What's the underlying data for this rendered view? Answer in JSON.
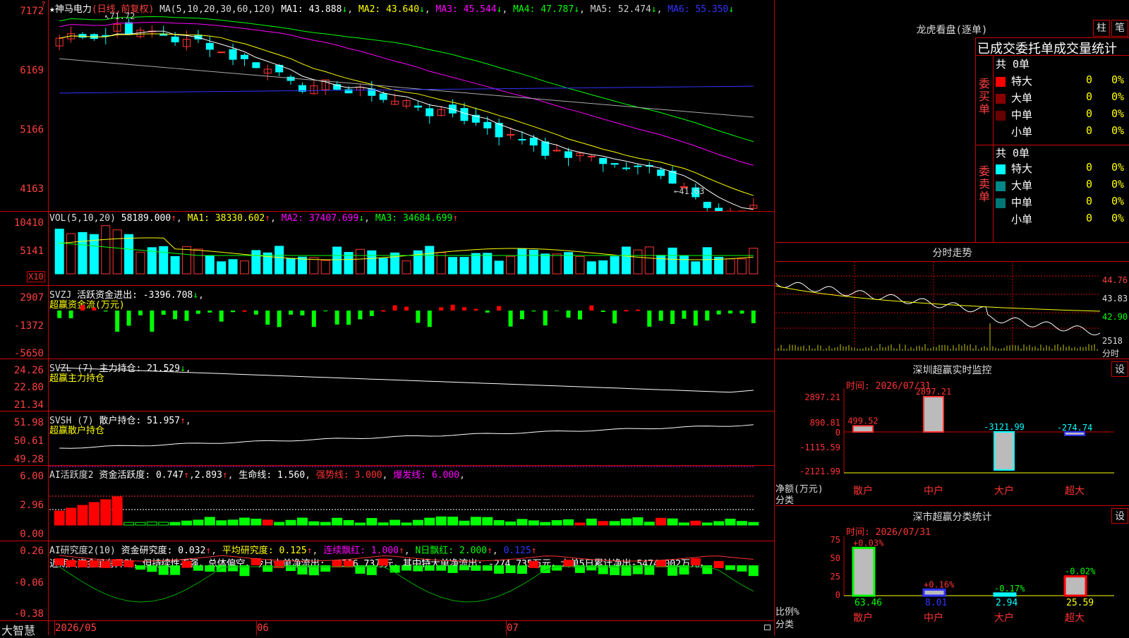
{
  "stock": {
    "star": "★",
    "name": "神马电力",
    "period": "(日线,前复权)",
    "ma_label": "MA(5,10,20,30,60,120)",
    "ma1": "MA1: 43.888",
    "ma2": "MA2: 43.640",
    "ma3": "MA3: 45.544",
    "ma4": "MA4: 47.787",
    "ma5": "MA5: 52.474",
    "ma6": "MA6: 55.350",
    "high_mark": "71.72",
    "low_mark": "←41.63",
    "top_close_icon": "?"
  },
  "price_axis": [
    "7172",
    "6169",
    "5166",
    "4163"
  ],
  "vol": {
    "label": "VOL(5,10,20)",
    "value": "58189.000",
    "ma1": "MA1: 38330.602",
    "ma2": "MA2: 37407.699",
    "ma3": "MA3: 34684.699",
    "axis": [
      "10410",
      "5141"
    ],
    "unit": "X10"
  },
  "svzj": {
    "label": "SVZJ",
    "text": "活跃资金进出: -3396.708",
    "sub": "超赢资金流(万元)",
    "axis": [
      "2907",
      "-1372",
      "-5650"
    ]
  },
  "svzl": {
    "label": "SVZL (7)",
    "text": "主力持仓: 21.529",
    "sub": "超赢主力持仓",
    "axis": [
      "24.26",
      "22.80",
      "21.34"
    ]
  },
  "svsh": {
    "label": "SVSH (7)",
    "text": "散户持仓: 51.957",
    "sub": "超赢散户持仓",
    "axis": [
      "51.98",
      "50.61",
      "49.28"
    ]
  },
  "ai1": {
    "label": "AI活跃度2",
    "t1": "资金活跃度: 0.747",
    "t2": "2.893",
    "t3": "生命线: 1.560",
    "t4": "强势线: 3.000",
    "t5": "爆发线: 6.000",
    "axis": [
      "6.00",
      "2.96",
      "0.00"
    ]
  },
  "ai2": {
    "label": "AI研究度2(10)",
    "t1": "资金研究度: 0.032",
    "t2": "平均研究度: 0.125",
    "t3": "连续飘红: 1.000",
    "t4": "N日飘红: 2.000",
    "t5": "0.125",
    "axis": [
      "0.26",
      "-0.06",
      "-0.38"
    ],
    "comment": "近期大资金虽有异动，但持续性不强，总体偏空，今日大单净流出: -3396.73万元，其中特大单净流出: -274.735万元，大单5日累计净出-5474.002万元，"
  },
  "bottom": {
    "logo": "大智慧",
    "dates": [
      "2026/05",
      "06",
      "07"
    ]
  },
  "longhu": {
    "title": "龙虎看盘(逐单)",
    "btn1": "柱",
    "btn2": "笔",
    "header": "已成交委托单成交量统计",
    "buy": {
      "side": "委买单",
      "total": "共 0单",
      "rows": [
        {
          "name": "特大",
          "v": "0",
          "p": "0%"
        },
        {
          "name": "大单",
          "v": "0",
          "p": "0%"
        },
        {
          "name": "中单",
          "v": "0",
          "p": "0%"
        },
        {
          "name": "小单",
          "v": "0",
          "p": "0%"
        }
      ]
    },
    "sell": {
      "side": "委卖单",
      "total": "共 0单",
      "rows": [
        {
          "name": "特大",
          "v": "0",
          "p": "0%"
        },
        {
          "name": "大单",
          "v": "0",
          "p": "0%"
        },
        {
          "name": "中单",
          "v": "0",
          "p": "0%"
        },
        {
          "name": "小单",
          "v": "0",
          "p": "0%"
        }
      ]
    }
  },
  "fenshi": {
    "title": "分时走势",
    "axis": [
      "44.76",
      "43.83",
      "42.90",
      "2518"
    ],
    "unit": "分时"
  },
  "monitor": {
    "title": "深圳超赢实时监控",
    "btn": "设",
    "time": "时间: 2026/07/31",
    "axis": [
      "2897.21",
      "890.81",
      "0",
      "-1115.59",
      "-2121.99"
    ],
    "ylabel1": "净额(万元)",
    "ylabel2": "分类",
    "cats": [
      "散户",
      "中户",
      "大户",
      "超大"
    ],
    "vals": [
      "499.52",
      "2897.21",
      "-3121.99",
      "-274.74"
    ]
  },
  "stats": {
    "title": "深市超赢分类统计",
    "btn": "设",
    "time": "时间: 2026/07/31",
    "axis": [
      "75",
      "50",
      "25",
      "0"
    ],
    "ylabel1": "比例%",
    "ylabel2": "分类",
    "cats": [
      "散户",
      "中户",
      "大户",
      "超大"
    ],
    "top": [
      "+0.03%",
      "+0.16%",
      "-0.17%",
      "-0.02%"
    ],
    "bottom": [
      "63.46",
      "8.01",
      "2.94",
      "25.59"
    ]
  }
}
